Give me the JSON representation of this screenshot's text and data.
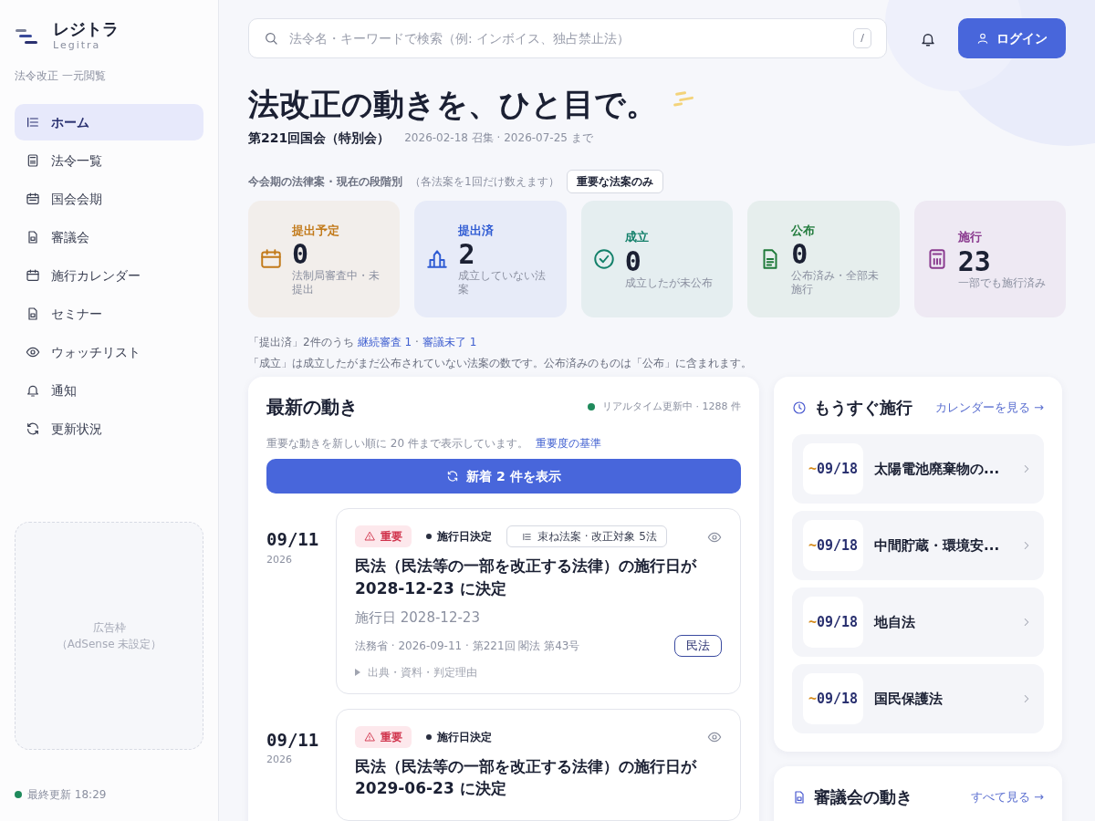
{
  "brand": {
    "name": "レジトラ",
    "sub": "Legitra",
    "tagline": "法令改正 一元閲覧"
  },
  "nav": [
    {
      "label": "ホーム",
      "selected": true
    },
    {
      "label": "法令一覧",
      "selected": false
    },
    {
      "label": "国会会期",
      "selected": false
    },
    {
      "label": "審議会",
      "selected": false
    },
    {
      "label": "施行カレンダー",
      "selected": false
    },
    {
      "label": "セミナー",
      "selected": false
    },
    {
      "label": "ウォッチリスト",
      "selected": false
    },
    {
      "label": "通知",
      "selected": false
    },
    {
      "label": "更新状況",
      "selected": false
    }
  ],
  "ad": {
    "title": "広告枠",
    "note": "（AdSense 未設定）"
  },
  "last_update": "最終更新 18:29",
  "search": {
    "placeholder": "法令名・キーワードで検索（例: インボイス、独占禁止法）",
    "shortcut": "/"
  },
  "login": "ログイン",
  "hero": {
    "title": "法改正の動きを、ひと目で。",
    "session": "第221回国会（特別会）",
    "period": "2026-02-18 召集 · 2026-07-25 まで"
  },
  "stages": {
    "label": "今会期の法律案 · 現在の段階別",
    "note": "（各法案を1回だけ数えます）",
    "filter": "重要な法案のみ",
    "items": [
      {
        "label": "提出予定",
        "count": "0",
        "note": "法制局審査中・未提出",
        "color": "#c27a1a"
      },
      {
        "label": "提出済",
        "count": "2",
        "note": "成立していない法案",
        "color": "#2f5bd3"
      },
      {
        "label": "成立",
        "count": "0",
        "note": "成立したが未公布",
        "color": "#13806a"
      },
      {
        "label": "公布",
        "count": "0",
        "note": "公布済み・全部未施行",
        "color": "#1f7a3a"
      },
      {
        "label": "施行",
        "count": "23",
        "note": "一部でも施行済み",
        "color": "#8a3a8f"
      }
    ]
  },
  "stage_notes": {
    "lead": "「提出済」2件のうち",
    "links": [
      "継続審査 1",
      "審議未了 1"
    ],
    "separator": "·",
    "text": "「成立」は成立したがまだ公布されていない法案の数です。公布済みのものは「公布」に含まれます。"
  },
  "feed": {
    "title": "最新の動き",
    "status": "リアルタイム更新中 · 1288 件",
    "description": "重要な動きを新しい順に 20 件まで表示しています。",
    "criteria": "重要度の基準",
    "new_button": "新着 2 件を表示",
    "items": [
      {
        "date": "09/11",
        "year": "2026",
        "important": "重要",
        "status": "施行日決定",
        "bundle": "束ね法案 · 改正対象 5法",
        "title": "民法（民法等の一部を改正する法律）の施行日が 2028-12-23 に決定",
        "effective": "施行日 2028-12-23",
        "meta": "法務省 · 2026-09-11 · 第221回 閣法 第43号",
        "tag": "民法",
        "details": "出典・資料・判定理由"
      },
      {
        "date": "09/11",
        "year": "2026",
        "important": "重要",
        "status": "施行日決定",
        "title": "民法（民法等の一部を改正する法律）の施行日が 2029-06-23 に決定"
      }
    ]
  },
  "soon": {
    "title": "もうすぐ施行",
    "link": "カレンダーを見る →",
    "items": [
      {
        "prefix": "~",
        "date": "09/18",
        "name": "太陽電池廃棄物の..."
      },
      {
        "prefix": "~",
        "date": "09/18",
        "name": "中間貯蔵・環境安..."
      },
      {
        "prefix": "~",
        "date": "09/18",
        "name": "地自法"
      },
      {
        "prefix": "~",
        "date": "09/18",
        "name": "国民保護法"
      }
    ]
  },
  "council": {
    "title": "審議会の動き",
    "link": "すべて見る →"
  }
}
